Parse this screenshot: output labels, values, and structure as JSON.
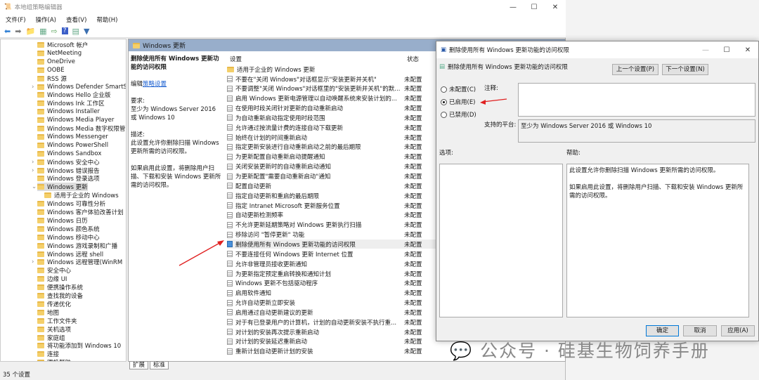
{
  "main": {
    "title": "本地组策略编辑器",
    "menu": [
      "文件(F)",
      "操作(A)",
      "查看(V)",
      "帮助(H)"
    ],
    "status": "35 个设置",
    "tree": [
      {
        "label": "Microsoft 帐户"
      },
      {
        "label": "NetMeeting"
      },
      {
        "label": "OneDrive"
      },
      {
        "label": "OOBE"
      },
      {
        "label": "RSS 源"
      },
      {
        "label": "Windows Defender SmartS",
        "exp": true
      },
      {
        "label": "Windows Hello 企业版"
      },
      {
        "label": "Windows Ink 工作区"
      },
      {
        "label": "Windows Installer"
      },
      {
        "label": "Windows Media Player"
      },
      {
        "label": "Windows Media 数字权限管"
      },
      {
        "label": "Windows Messenger"
      },
      {
        "label": "Windows PowerShell"
      },
      {
        "label": "Windows Sandbox"
      },
      {
        "label": "Windows 安全中心",
        "exp": true
      },
      {
        "label": "Windows 错误报告",
        "exp": true
      },
      {
        "label": "Windows 登录选项"
      },
      {
        "label": "Windows 更新",
        "open": true
      },
      {
        "label": "适用于企业的 Windows",
        "child": true
      },
      {
        "label": "Windows 可靠性分析"
      },
      {
        "label": "Windows 客户体验改善计划"
      },
      {
        "label": "Windows 日历"
      },
      {
        "label": "Windows 颜色系统"
      },
      {
        "label": "Windows 移动中心"
      },
      {
        "label": "Windows 游戏录制和广播"
      },
      {
        "label": "Windows 远程 shell"
      },
      {
        "label": "Windows 远程管理(WinRM",
        "exp": true
      },
      {
        "label": "安全中心"
      },
      {
        "label": "边缘 UI"
      },
      {
        "label": "便携操作系统"
      },
      {
        "label": "查找我的设备"
      },
      {
        "label": "传递优化"
      },
      {
        "label": "地图"
      },
      {
        "label": "工作文件夹"
      },
      {
        "label": "关机选项"
      },
      {
        "label": "家庭组"
      },
      {
        "label": "将功能添加到 Windows 10"
      },
      {
        "label": "连接"
      },
      {
        "label": "跟投帮助"
      }
    ],
    "pane_header": "Windows 更新",
    "desc": {
      "title": "删除使用所有 Windows 更新功能的访问权限",
      "edit": "编辑",
      "edit_link": "策略设置",
      "req_label": "要求:",
      "req": "至少为 Windows Server 2016 或 Windows 10",
      "desc_label": "描述:",
      "desc1": "此设置允许你删除扫描 Windows 更新所需的访问权限。",
      "desc2": "如果启用此设置，将删除用户扫描、下载和安装 Windows 更新所需的访问权限。"
    },
    "col_setting": "设置",
    "col_state": "状态",
    "folder_row": "适用于企业的 Windows 更新",
    "rows": [
      {
        "name": "不要在\"关闭 Windows\"对话框显示\"安装更新并关机\"",
        "state": "未配置"
      },
      {
        "name": "不要调整\"关闭 Windows\"对话框里的\"安装更新并关机\"的默...",
        "state": "未配置"
      },
      {
        "name": "启用 Windows 更新电源管理以自动唤醒系统来安装计划的...",
        "state": "未配置"
      },
      {
        "name": "在使用时段关闭针对更新的自动重新启动",
        "state": "未配置"
      },
      {
        "name": "为自动重新启动指定使用时段范围",
        "state": "未配置"
      },
      {
        "name": "允许通过按流量计费的连接自动下载更新",
        "state": "未配置"
      },
      {
        "name": "始终在计划的时间重新启动",
        "state": "未配置"
      },
      {
        "name": "指定更新安装进行自动重新启动之前的最后期限",
        "state": "未配置"
      },
      {
        "name": "为更新配置自动重新启动提醒通知",
        "state": "未配置"
      },
      {
        "name": "关闭安装更新时的自动重新启动通知",
        "state": "未配置"
      },
      {
        "name": "为更新配置\"需要自动重新启动\"通知",
        "state": "未配置"
      },
      {
        "name": "配置自动更新",
        "state": "未配置"
      },
      {
        "name": "指定自动更新和重启的最后期限",
        "state": "未配置"
      },
      {
        "name": "指定 Intranet Microsoft 更新服务位置",
        "state": "未配置"
      },
      {
        "name": "自动更新检测频率",
        "state": "未配置"
      },
      {
        "name": "不允许更新延期策略对 Windows 更新执行扫描",
        "state": "未配置"
      },
      {
        "name": "移除访问 \"暂停更新\" 功能",
        "state": "未配置"
      },
      {
        "name": "删除使用所有 Windows 更新功能的访问权限",
        "state": "未配置",
        "selected": true
      },
      {
        "name": "不要连接任何 Windows 更新 Internet 位置",
        "state": "未配置"
      },
      {
        "name": "允许非管理员接收更新通知",
        "state": "未配置"
      },
      {
        "name": "为更新指定预定重启转换和通知计划",
        "state": "未配置"
      },
      {
        "name": "Windows 更新不包括驱动程序",
        "state": "未配置"
      },
      {
        "name": "启用软件通知",
        "state": "未配置"
      },
      {
        "name": "允许自动更新立即安装",
        "state": "未配置"
      },
      {
        "name": "启用通过自动更新建议的更新",
        "state": "未配置"
      },
      {
        "name": "对于有已登录用户的计算机，计划的自动更新安装不执行重...",
        "state": "未配置"
      },
      {
        "name": "对计划的安装再次提示重新启动",
        "state": "未配置"
      },
      {
        "name": "对计划的安装延迟重新启动",
        "state": "未配置"
      },
      {
        "name": "重新计划自动更新计划的安装",
        "state": "未配置"
      }
    ],
    "tabs": [
      "扩展",
      "标准"
    ]
  },
  "dialog": {
    "title": "删除使用所有 Windows 更新功能的访问权限",
    "heading": "删除使用所有 Windows 更新功能的访问权限",
    "prev": "上一个设置(P)",
    "next": "下一个设置(N)",
    "radios": [
      {
        "label": "未配置(C)",
        "checked": false
      },
      {
        "label": "已启用(E)",
        "checked": true
      },
      {
        "label": "已禁用(D)",
        "checked": false
      }
    ],
    "comment_label": "注释:",
    "platform_label": "支持的平台:",
    "platform": "至少为 Windows Server 2016 或 Windows 10",
    "options_label": "选项:",
    "help_label": "帮助:",
    "help1": "此设置允许你删除扫描 Windows 更新所需的访问权限。",
    "help2": "如果启用此设置，将删除用户扫描、下载和安装 Windows 更新所需的访问权限。",
    "ok": "确定",
    "cancel": "取消",
    "apply": "应用(A)"
  },
  "watermark": "公众号 · 硅基生物饲养手册"
}
